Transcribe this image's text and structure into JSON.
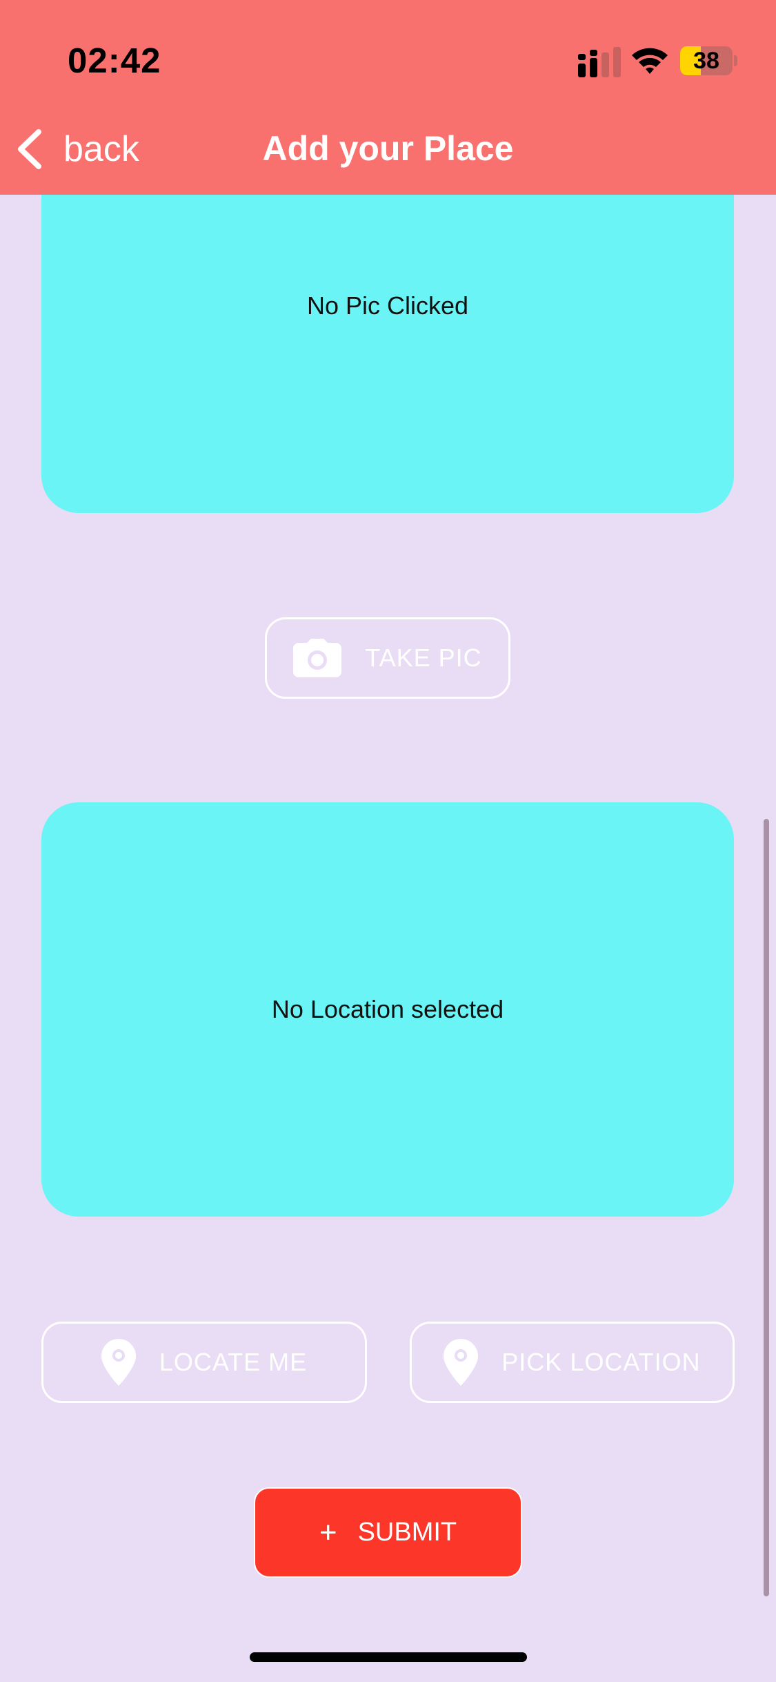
{
  "status_bar": {
    "time": "02:42",
    "battery_level": "38",
    "icons": [
      "cellular-signal-icon",
      "wifi-icon",
      "battery-icon"
    ]
  },
  "nav": {
    "back_label": "back",
    "title": "Add your Place"
  },
  "image_preview": {
    "placeholder_text": "No Pic Clicked"
  },
  "take_pic_button": {
    "label": "TAKE PIC",
    "icon": "camera-icon"
  },
  "location_preview": {
    "placeholder_text": "No Location selected"
  },
  "location_buttons": {
    "locate_me": {
      "label": "LOCATE ME",
      "icon": "map-pin-icon"
    },
    "pick_location": {
      "label": "PICK LOCATION",
      "icon": "map-pin-icon"
    }
  },
  "submit_button": {
    "label": "SUBMIT",
    "icon_text": "+"
  },
  "colors": {
    "header": "#F9716E",
    "background": "#E9DCF5",
    "preview_card": "#6BF4F5",
    "submit": "#FC3628"
  }
}
